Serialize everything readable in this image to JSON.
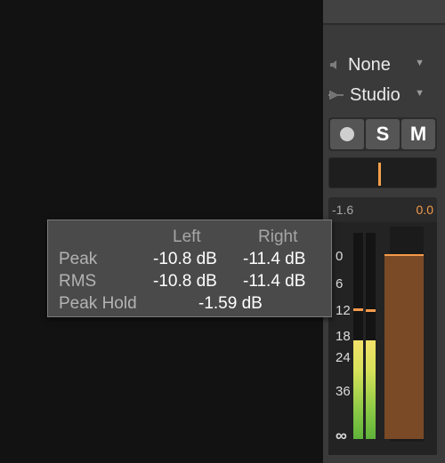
{
  "io": {
    "input_label": "None",
    "output_label": "Studio"
  },
  "buttons": {
    "record_label": "",
    "solo_label": "S",
    "mute_label": "M"
  },
  "meter": {
    "left_readout": "-1.6",
    "right_readout": "0.0",
    "scale": [
      "0",
      "6",
      "12",
      "18",
      "24",
      "36",
      "∞"
    ],
    "left_level_fraction": 0.48,
    "right_level_fraction": 0.48,
    "fader_level_fraction": 0.86
  },
  "tooltip": {
    "col_left": "Left",
    "col_right": "Right",
    "rows": {
      "peak": {
        "label": "Peak",
        "left": "-10.8 dB",
        "right": "-11.4 dB"
      },
      "rms": {
        "label": "RMS",
        "left": "-10.8 dB",
        "right": "-11.4 dB"
      },
      "peak_hold": {
        "label": "Peak Hold",
        "value": "-1.59 dB"
      }
    }
  },
  "colors": {
    "accent": "#f49a4a",
    "panel": "#3a3a3a",
    "tooltip_bg": "#4a4a4a"
  }
}
